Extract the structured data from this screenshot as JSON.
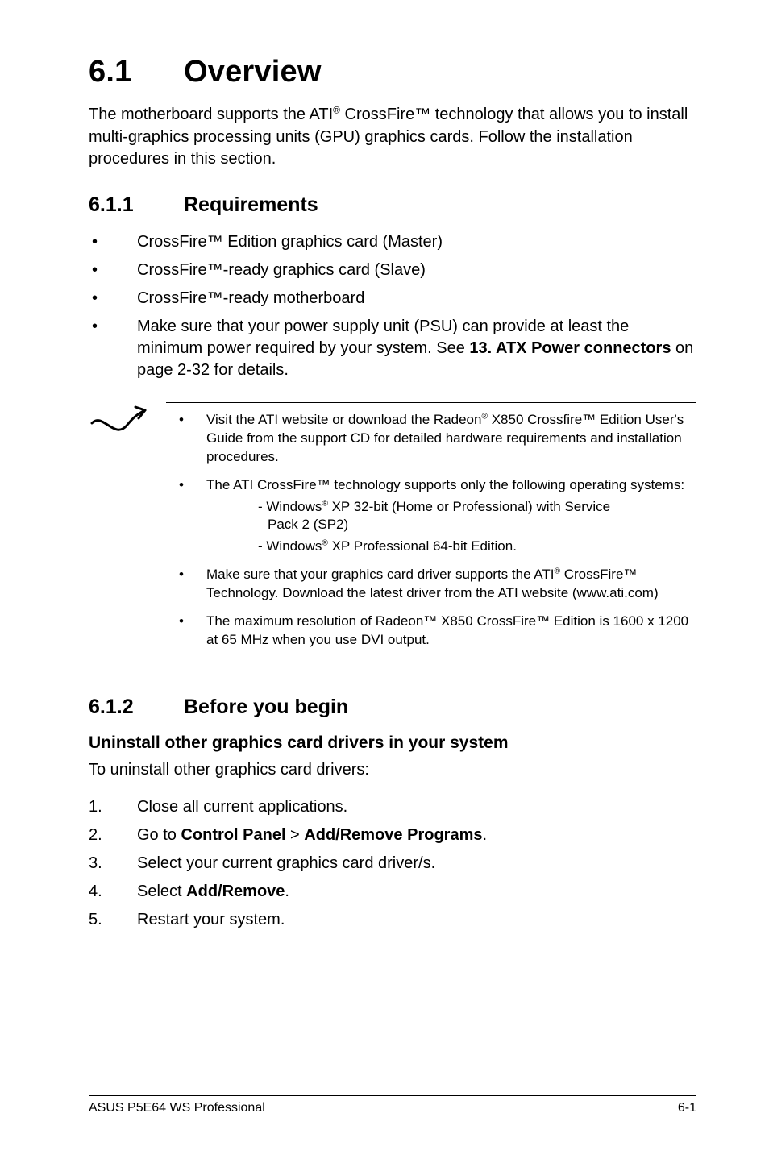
{
  "title": {
    "num": "6.1",
    "text": "Overview"
  },
  "intro": "The motherboard supports the ATI® CrossFire™ technology that allows you to install multi-graphics processing units (GPU) graphics cards. Follow the installation procedures in this section.",
  "sub611": {
    "num": "6.1.1",
    "text": "Requirements"
  },
  "req": [
    "CrossFire™ Edition graphics card (Master)",
    "CrossFire™-ready graphics card (Slave)",
    "CrossFire™-ready motherboard",
    "Make sure that your power supply unit (PSU) can provide at least the minimum power required by your system. See 13. ATX Power connectors on page 2-32 for details."
  ],
  "req_bold": {
    "label": "13. ATX Power connectors"
  },
  "notes": {
    "n1": "Visit the ATI website or download the Radeon® X850 Crossfire™ Edition User's Guide from the support CD for detailed hardware requirements and installation procedures.",
    "n2_lead": "The ATI CrossFire™ technology supports only the following operating systems:",
    "n2_a1": "- Windows® XP 32-bit  (Home or Professional) with Service",
    "n2_a1b": "Pack 2 (SP2)",
    "n2_a2": "- Windows® XP Professional 64-bit Edition.",
    "n3": "Make sure that your graphics card driver supports the ATI® CrossFire™ Technology. Download the latest driver from the ATI website (www.ati.com)",
    "n4": "The maximum resolution of Radeon™ X850 CrossFire™ Edition is 1600 x 1200 at 65 MHz when you use DVI output."
  },
  "sub612": {
    "num": "6.1.2",
    "text": "Before you begin"
  },
  "uninstall_h": "Uninstall other graphics card drivers in your system",
  "uninstall_p": "To uninstall other graphics card drivers:",
  "steps": {
    "s1": "Close all current applications.",
    "s2a": "Go to ",
    "s2b": "Control Panel",
    "s2c": " > ",
    "s2d": "Add/Remove Programs",
    "s2e": ".",
    "s3": "Select your current graphics card driver/s.",
    "s4a": "Select ",
    "s4b": "Add/Remove",
    "s4c": ".",
    "s5": "Restart your system."
  },
  "footer": {
    "left": "ASUS P5E64 WS Professional",
    "right": "6-1"
  }
}
